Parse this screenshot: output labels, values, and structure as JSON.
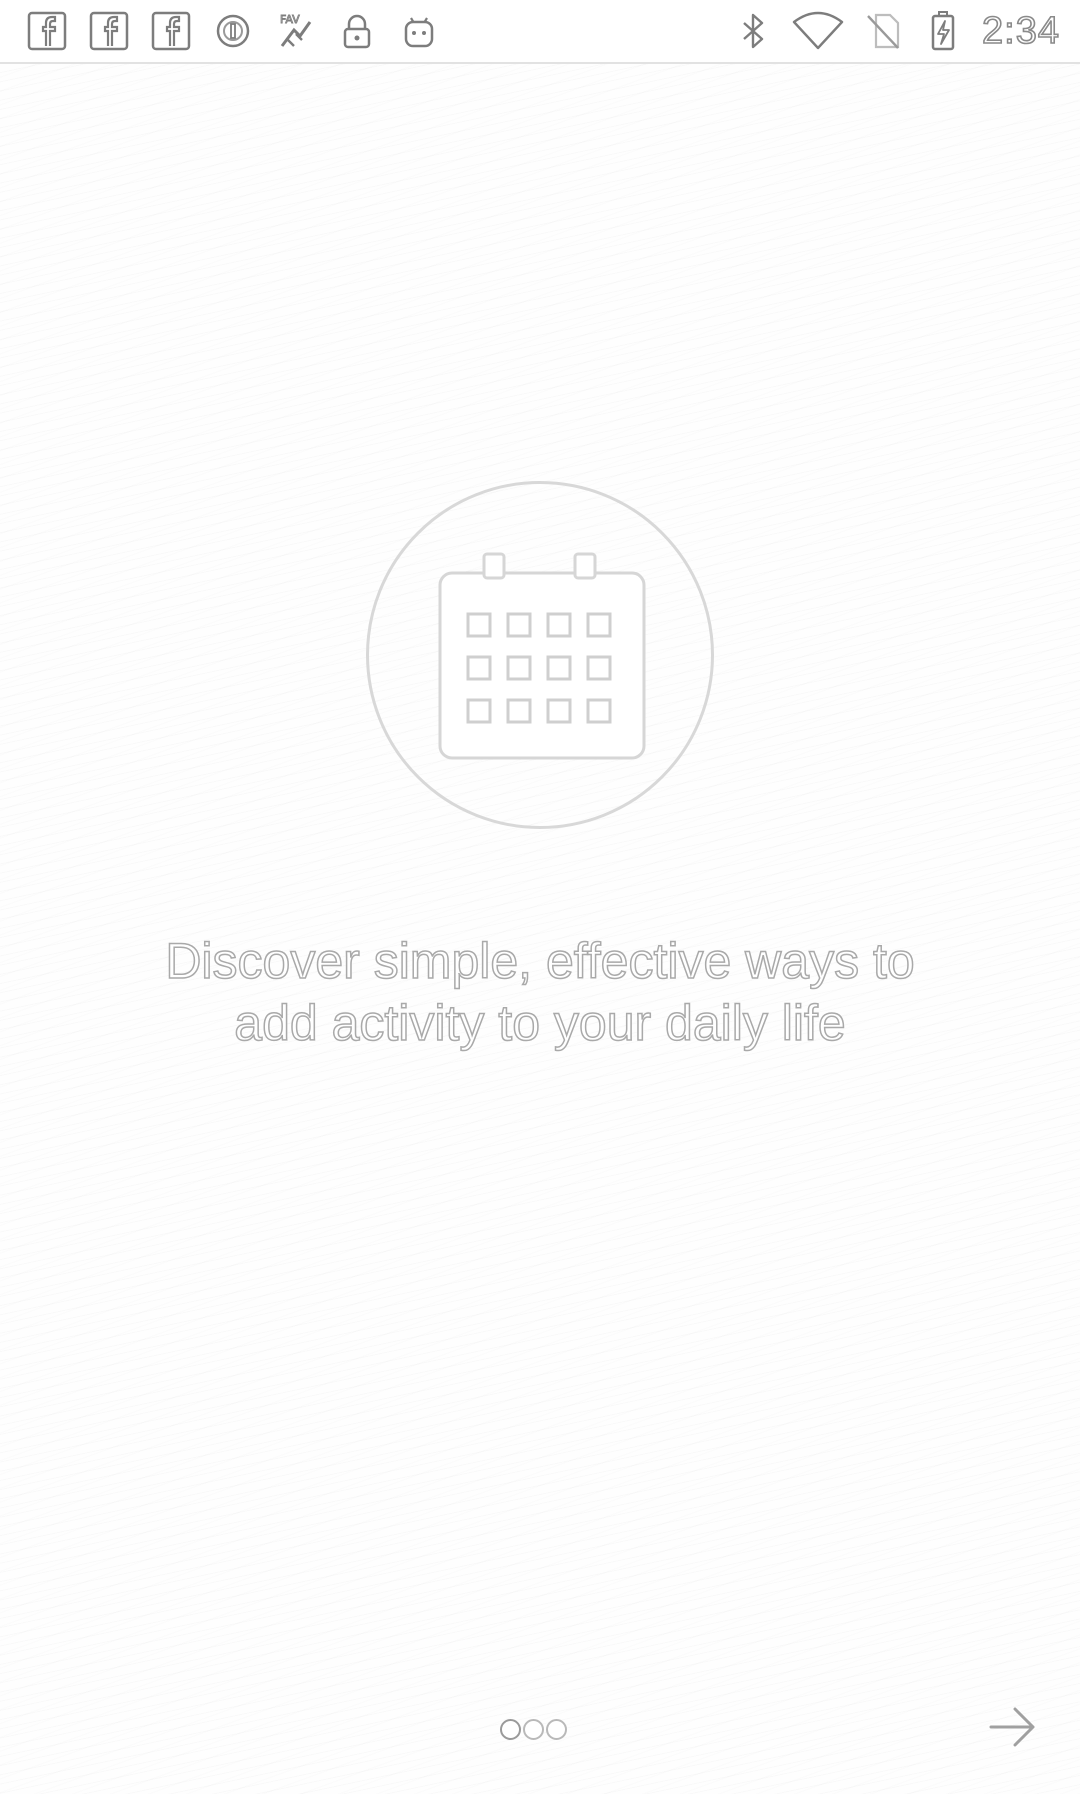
{
  "status_bar": {
    "time": "2:34",
    "left_icons": [
      "facebook-icon",
      "facebook-icon",
      "facebook-icon",
      "circle-notification-icon",
      "fav-app-icon",
      "lock-icon",
      "android-icon"
    ],
    "right_icons": [
      "bluetooth-icon",
      "wifi-icon",
      "no-sim-icon",
      "battery-charging-icon"
    ]
  },
  "onboarding": {
    "hero_icon": "calendar-icon",
    "headline_line1": "Discover simple, effective ways to",
    "headline_line2": "add activity to your daily life",
    "page_count": 3,
    "current_page": 1,
    "next_icon": "arrow-right-icon"
  },
  "colors": {
    "background": "#fefefe",
    "outline": "#a9a9a9",
    "divider": "#e2e2e2"
  }
}
